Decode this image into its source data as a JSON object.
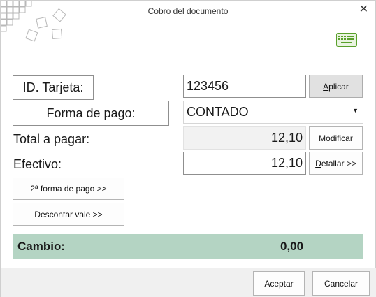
{
  "window": {
    "title": "Cobro del documento",
    "close_glyph": "✕"
  },
  "icons": {
    "logo": "squares-logo-icon",
    "keyboard": "keyboard-icon",
    "close": "close-icon"
  },
  "card": {
    "label": "ID. Tarjeta:",
    "value": "123456",
    "apply_label": "Aplicar",
    "apply_accel": "A",
    "apply_rest": "plicar"
  },
  "payment": {
    "label": "Forma de pago:",
    "selected": "CONTADO"
  },
  "total": {
    "label": "Total a pagar:",
    "value": "12,10",
    "modify_label": "Modificar"
  },
  "cash": {
    "label": "Efectivo:",
    "value": "12,10",
    "detail_accel": "D",
    "detail_rest": "etallar >>",
    "detail_label": "Detallar >>"
  },
  "buttons": {
    "second_payment": "2ª forma de pago >>",
    "discount_voucher": "Descontar vale >>"
  },
  "change": {
    "label": "Cambio:",
    "value": "0,00"
  },
  "footer": {
    "accept": "Aceptar",
    "cancel": "Cancelar"
  },
  "colors": {
    "change_bar": "#b4d4c3",
    "keyboard_icon": "#5aa02c"
  }
}
